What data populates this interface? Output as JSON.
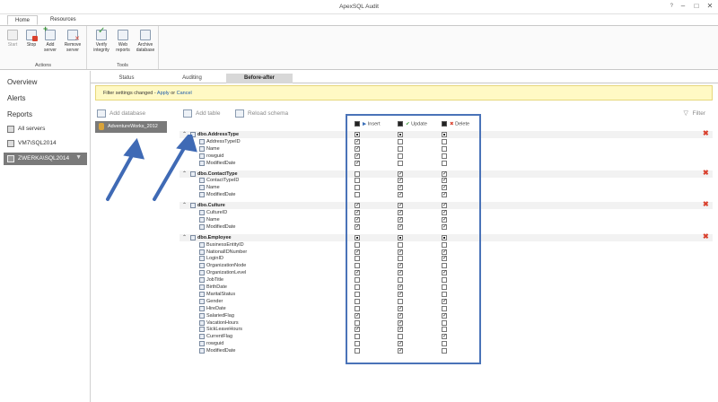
{
  "window": {
    "title": "ApexSQL Audit",
    "help": "?",
    "minimize": "–",
    "maximize": "□",
    "close": "✕"
  },
  "ribbon_tabs": [
    "Home",
    "Resources"
  ],
  "ribbon": {
    "actions_label": "Actions",
    "tools_label": "Tools",
    "start": "Start",
    "stop": "Stop",
    "add_server_1": "Add",
    "add_server_2": "server",
    "remove_server_1": "Remove",
    "remove_server_2": "server",
    "verify_1": "Verify",
    "verify_2": "integrity",
    "web_1": "Web",
    "web_2": "reports",
    "archive_1": "Archive",
    "archive_2": "database"
  },
  "nav": {
    "overview": "Overview",
    "alerts": "Alerts",
    "reports": "Reports",
    "all_servers": "All servers",
    "server1": "VM7\\SQL2014",
    "server2": "ZWERKA\\SQL2014"
  },
  "subtabs": [
    "Status",
    "Auditing",
    "Before-after"
  ],
  "banner": {
    "text": "Filter settings changed - ",
    "apply": "Apply",
    "or": " or ",
    "cancel": "Cancel"
  },
  "toolbar": {
    "add_database": "Add database",
    "add_table": "Add table",
    "reload_schema": "Reload schema",
    "filter": "Filter"
  },
  "database": "AdventureWorks_2012",
  "columns": {
    "insert": "Insert",
    "update": "Update",
    "delete": "Delete"
  },
  "tree": [
    {
      "name": "dbo.AddressType",
      "kind": "table",
      "checks": [
        "sq",
        "sq",
        "sq"
      ]
    },
    {
      "name": "AddressTypeID",
      "kind": "column",
      "checks": [
        "v",
        "",
        ""
      ]
    },
    {
      "name": "Name",
      "kind": "column",
      "checks": [
        "v",
        "",
        ""
      ]
    },
    {
      "name": "rowguid",
      "kind": "column",
      "checks": [
        "v",
        "",
        ""
      ]
    },
    {
      "name": "ModifiedDate",
      "kind": "column",
      "checks": [
        "v",
        "",
        ""
      ]
    },
    {
      "name": "dbo.ContactType",
      "kind": "table",
      "checks": [
        "",
        "v",
        "v"
      ]
    },
    {
      "name": "ContactTypeID",
      "kind": "column",
      "checks": [
        "",
        "v",
        "v"
      ]
    },
    {
      "name": "Name",
      "kind": "column",
      "checks": [
        "",
        "v",
        "v"
      ]
    },
    {
      "name": "ModifiedDate",
      "kind": "column",
      "checks": [
        "",
        "v",
        "v"
      ]
    },
    {
      "name": "dbo.Culture",
      "kind": "table",
      "checks": [
        "v",
        "v",
        "v"
      ]
    },
    {
      "name": "CultureID",
      "kind": "column",
      "checks": [
        "v",
        "v",
        "v"
      ]
    },
    {
      "name": "Name",
      "kind": "column",
      "checks": [
        "v",
        "v",
        "v"
      ]
    },
    {
      "name": "ModifiedDate",
      "kind": "column",
      "checks": [
        "v",
        "v",
        "v"
      ]
    },
    {
      "name": "dbo.Employee",
      "kind": "table",
      "checks": [
        "sq",
        "sq",
        "sq"
      ]
    },
    {
      "name": "BusinessEntityID",
      "kind": "column",
      "checks": [
        "",
        "",
        ""
      ]
    },
    {
      "name": "NationalIDNumber",
      "kind": "column",
      "checks": [
        "v",
        "v",
        "v"
      ]
    },
    {
      "name": "LoginID",
      "kind": "column",
      "checks": [
        "",
        "",
        "v"
      ]
    },
    {
      "name": "OrganizationNode",
      "kind": "column",
      "checks": [
        "",
        "v",
        ""
      ]
    },
    {
      "name": "OrganizationLevel",
      "kind": "column",
      "checks": [
        "v",
        "v",
        "v"
      ]
    },
    {
      "name": "JobTitle",
      "kind": "column",
      "checks": [
        "",
        "",
        ""
      ]
    },
    {
      "name": "BirthDate",
      "kind": "column",
      "checks": [
        "",
        "v",
        ""
      ]
    },
    {
      "name": "MaritalStatus",
      "kind": "column",
      "checks": [
        "",
        "v",
        ""
      ]
    },
    {
      "name": "Gender",
      "kind": "column",
      "checks": [
        "",
        "",
        "v"
      ]
    },
    {
      "name": "HireDate",
      "kind": "column",
      "checks": [
        "",
        "v",
        ""
      ]
    },
    {
      "name": "SalariedFlag",
      "kind": "column",
      "checks": [
        "v",
        "v",
        "v"
      ]
    },
    {
      "name": "VacationHours",
      "kind": "column",
      "checks": [
        "",
        "v",
        ""
      ]
    },
    {
      "name": "SickLeaveHours",
      "kind": "column",
      "checks": [
        "v",
        "v",
        ""
      ]
    },
    {
      "name": "CurrentFlag",
      "kind": "column",
      "checks": [
        "",
        "",
        "v"
      ]
    },
    {
      "name": "rowguid",
      "kind": "column",
      "checks": [
        "",
        "v",
        ""
      ]
    },
    {
      "name": "ModifiedDate",
      "kind": "column",
      "checks": [
        "",
        "v",
        ""
      ]
    }
  ],
  "colors": {
    "accent": "#4a73b8",
    "delete": "#d9412e",
    "banner": "#fff9c4",
    "selected": "#7a7a7a"
  }
}
